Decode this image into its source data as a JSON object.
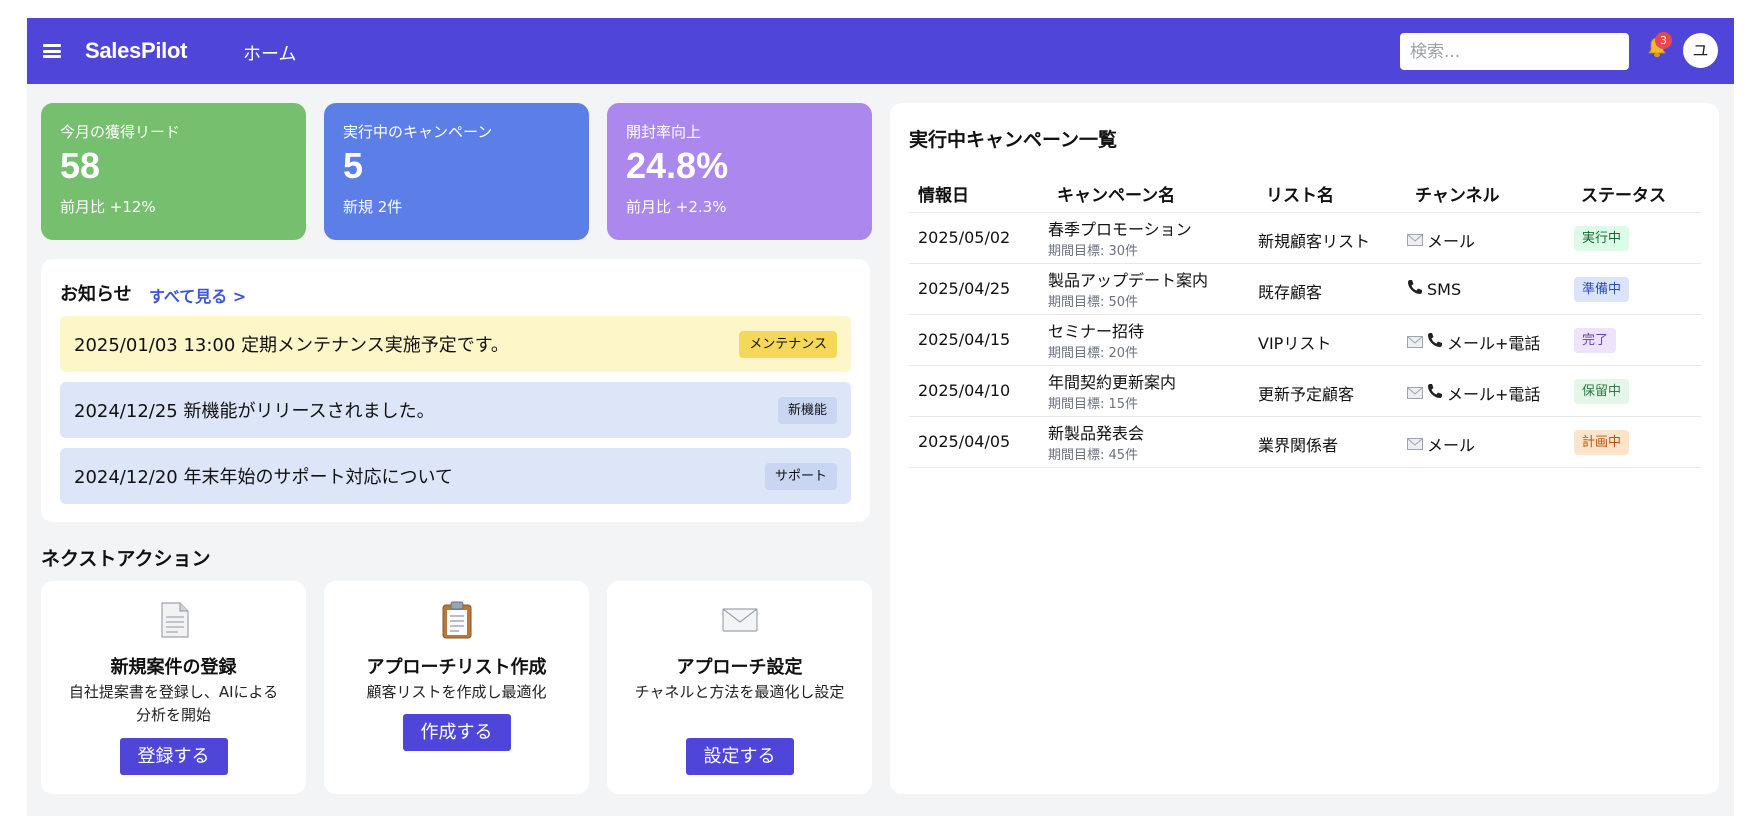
{
  "app": {
    "logo": "SalesPilot",
    "nav_home": "ホーム"
  },
  "header": {
    "search_placeholder": "検索...",
    "notification_count": "3",
    "avatar_initial": "ユ"
  },
  "stats": [
    {
      "label": "今月の獲得リード",
      "value": "58",
      "sub": "前月比 +12%",
      "color": "#76bf6e"
    },
    {
      "label": "実行中のキャンペーン",
      "value": "5",
      "sub": "新規 2件",
      "color": "#5b7fe6"
    },
    {
      "label": "開封率向上",
      "value": "24.8%",
      "sub": "前月比 +2.3%",
      "color": "#ab87ee"
    }
  ],
  "news": {
    "title": "お知らせ",
    "view_all": "すべて見る >",
    "items": [
      {
        "text": "2025/01/03 13:00 定期メンテナンス実施予定です。",
        "tag": "メンテナンス",
        "bg": "#fdf6c8",
        "tag_bg": "#f5d75a"
      },
      {
        "text": "2024/12/25 新機能がリリースされました。",
        "tag": "新機能",
        "bg": "#dde6f8",
        "tag_bg": "#c9d6f2"
      },
      {
        "text": "2024/12/20 年末年始のサポート対応について",
        "tag": "サポート",
        "bg": "#dde6f8",
        "tag_bg": "#c9d6f2"
      }
    ]
  },
  "next_actions": {
    "title": "ネクストアクション",
    "items": [
      {
        "icon": "document-icon",
        "title": "新規案件の登録",
        "desc": "自社提案書を登録し、AIによる分析を開始",
        "button": "登録する"
      },
      {
        "icon": "clipboard-icon",
        "title": "アプローチリスト作成",
        "desc": "顧客リストを作成し最適化",
        "button": "作成する"
      },
      {
        "icon": "envelope-icon",
        "title": "アプローチ設定",
        "desc": "チャネルと方法を最適化し設定",
        "button": "設定する"
      }
    ]
  },
  "campaigns": {
    "title": "実行中キャンペーン一覧",
    "headers": [
      "情報日",
      "キャンペーン名",
      "リスト名",
      "チャンネル",
      "ステータス"
    ],
    "rows": [
      {
        "date": "2025/05/02",
        "name": "春季プロモーション",
        "goal": "期間目標: 30件",
        "list": "新規顧客リスト",
        "channel": "メール",
        "channel_icons": [
          "envelope-icon"
        ],
        "status": "実行中",
        "status_bg": "#dcfce7",
        "status_fg": "#166534"
      },
      {
        "date": "2025/04/25",
        "name": "製品アップデート案内",
        "goal": "期間目標: 50件",
        "list": "既存顧客",
        "channel": "SMS",
        "channel_icons": [
          "phone-icon"
        ],
        "status": "準備中",
        "status_bg": "#dbe4fb",
        "status_fg": "#2b4db3"
      },
      {
        "date": "2025/04/15",
        "name": "セミナー招待",
        "goal": "期間目標: 20件",
        "list": "VIPリスト",
        "channel": "メール+電話",
        "channel_icons": [
          "envelope-icon",
          "phone-icon"
        ],
        "status": "完了",
        "status_bg": "#ede3fb",
        "status_fg": "#6b3fb3"
      },
      {
        "date": "2025/04/10",
        "name": "年間契約更新案内",
        "goal": "期間目標: 15件",
        "list": "更新予定顧客",
        "channel": "メール+電話",
        "channel_icons": [
          "envelope-icon",
          "phone-icon"
        ],
        "status": "保留中",
        "status_bg": "#e3f6e8",
        "status_fg": "#2f7a45"
      },
      {
        "date": "2025/04/05",
        "name": "新製品発表会",
        "goal": "期間目標: 45件",
        "list": "業界関係者",
        "channel": "メール",
        "channel_icons": [
          "envelope-icon"
        ],
        "status": "計画中",
        "status_bg": "#fde3c8",
        "status_fg": "#b45309"
      }
    ]
  }
}
